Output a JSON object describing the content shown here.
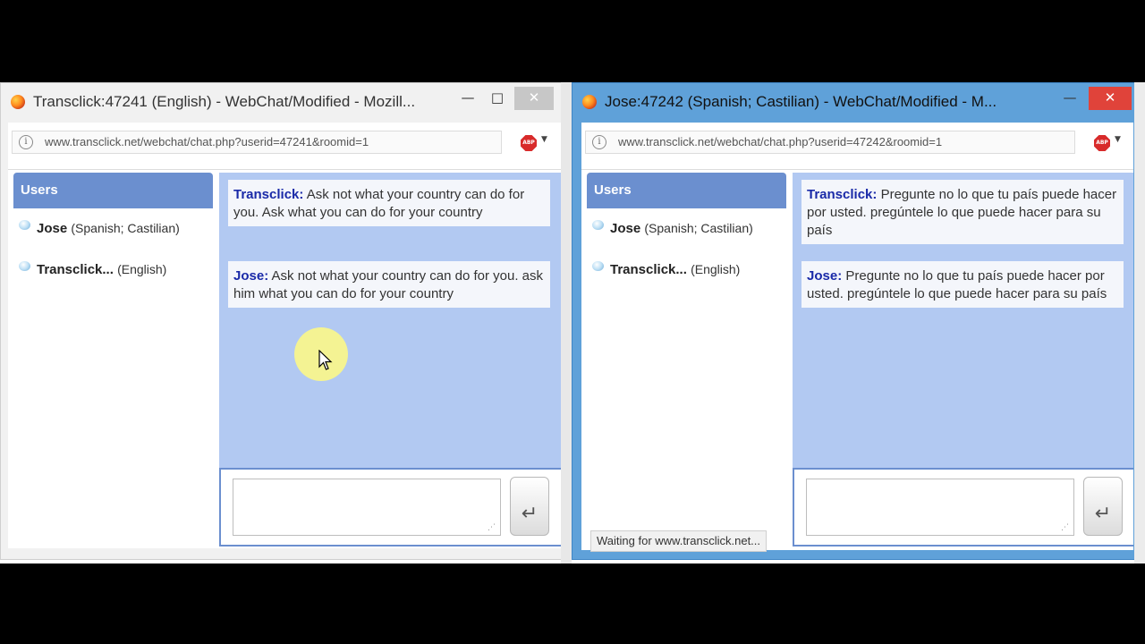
{
  "left_window": {
    "title": "Transclick:47241 (English) - WebChat/Modified - Mozill...",
    "url": "www.transclick.net/webchat/chat.php?userid=47241&roomid=1",
    "users_header": "Users",
    "users": [
      {
        "name": "Jose",
        "lang": "(Spanish; Castilian)"
      },
      {
        "name": "Transclick...",
        "lang": "(English)"
      }
    ],
    "messages": [
      {
        "who": "Transclick:",
        "text": "Ask not what your country can do for you. Ask what you can do for your country"
      },
      {
        "who": "Jose:",
        "text": "Ask not what your country can do for you. ask him what you can do for your country"
      }
    ],
    "input_value": ""
  },
  "right_window": {
    "title": "Jose:47242 (Spanish; Castilian) - WebChat/Modified - M...",
    "url": "www.transclick.net/webchat/chat.php?userid=47242&roomid=1",
    "users_header": "Users",
    "users": [
      {
        "name": "Jose",
        "lang": "(Spanish; Castilian)"
      },
      {
        "name": "Transclick...",
        "lang": "(English)"
      }
    ],
    "messages": [
      {
        "who": "Transclick:",
        "text": "Pregunte no lo que tu país puede hacer por usted. pregúntele lo que puede hacer para su país"
      },
      {
        "who": "Jose:",
        "text": "Pregunte no lo que tu país puede hacer por usted. pregúntele lo que puede hacer para su país"
      }
    ],
    "input_value": "",
    "status_text": "Waiting for www.transclick.net..."
  },
  "icons": {
    "browser": "firefox-icon",
    "adblock": "adblock-plus-icon",
    "info": "info-icon",
    "send": "return-arrow-icon"
  },
  "colors": {
    "users_header": "#6b8fcf",
    "chat_background": "#b2c9f2",
    "sender_name": "#1a2aa8",
    "active_window_frame": "#5fa1d9",
    "close_active": "#e0433a"
  }
}
